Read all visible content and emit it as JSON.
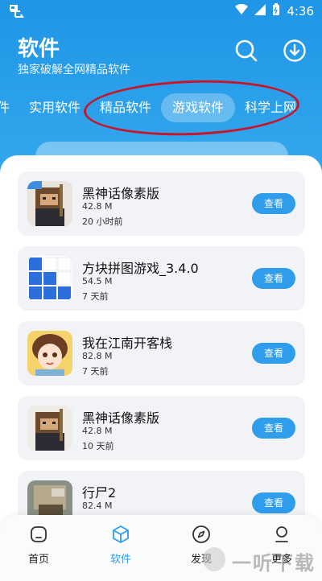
{
  "status_bar": {
    "time": "4:36",
    "left_icon": "app-notification-icon",
    "icons": [
      "wifi-icon",
      "signal-icon",
      "battery-icon"
    ]
  },
  "header": {
    "title": "软件",
    "subtitle": "独家破解全网精品软件",
    "search_icon": "search-icon",
    "download_icon": "download-icon"
  },
  "tabs": [
    {
      "label": "件",
      "active": false
    },
    {
      "label": "实用软件",
      "active": false
    },
    {
      "label": "精品软件",
      "active": false
    },
    {
      "label": "游戏软件",
      "active": true
    },
    {
      "label": "科学上网",
      "active": false
    }
  ],
  "apps": [
    {
      "name": "黑神话像素版",
      "size": "42.8 M",
      "time": "20 小时前",
      "button": "查看"
    },
    {
      "name": "方块拼图游戏_3.4.0",
      "size": "54.5 M",
      "time": "7 天前",
      "button": "查看"
    },
    {
      "name": "我在江南开客栈",
      "size": "82.8 M",
      "time": "7 天前",
      "button": "查看"
    },
    {
      "name": "黑神话像素版",
      "size": "42.8 M",
      "time": "10 天前",
      "button": "查看"
    },
    {
      "name": "行尸2",
      "size": "82.4 M",
      "time": "",
      "button": "查看"
    }
  ],
  "bottom_nav": [
    {
      "label": "首页",
      "icon": "home-icon",
      "active": false
    },
    {
      "label": "软件",
      "icon": "cube-icon",
      "active": true
    },
    {
      "label": "发现",
      "icon": "compass-icon",
      "active": false
    },
    {
      "label": "更多",
      "icon": "user-icon",
      "active": false
    }
  ],
  "watermark": "一听下载",
  "colors": {
    "primary": "#2f9cec",
    "header": "#1f95e6",
    "highlight_oval": "#c7162b"
  }
}
